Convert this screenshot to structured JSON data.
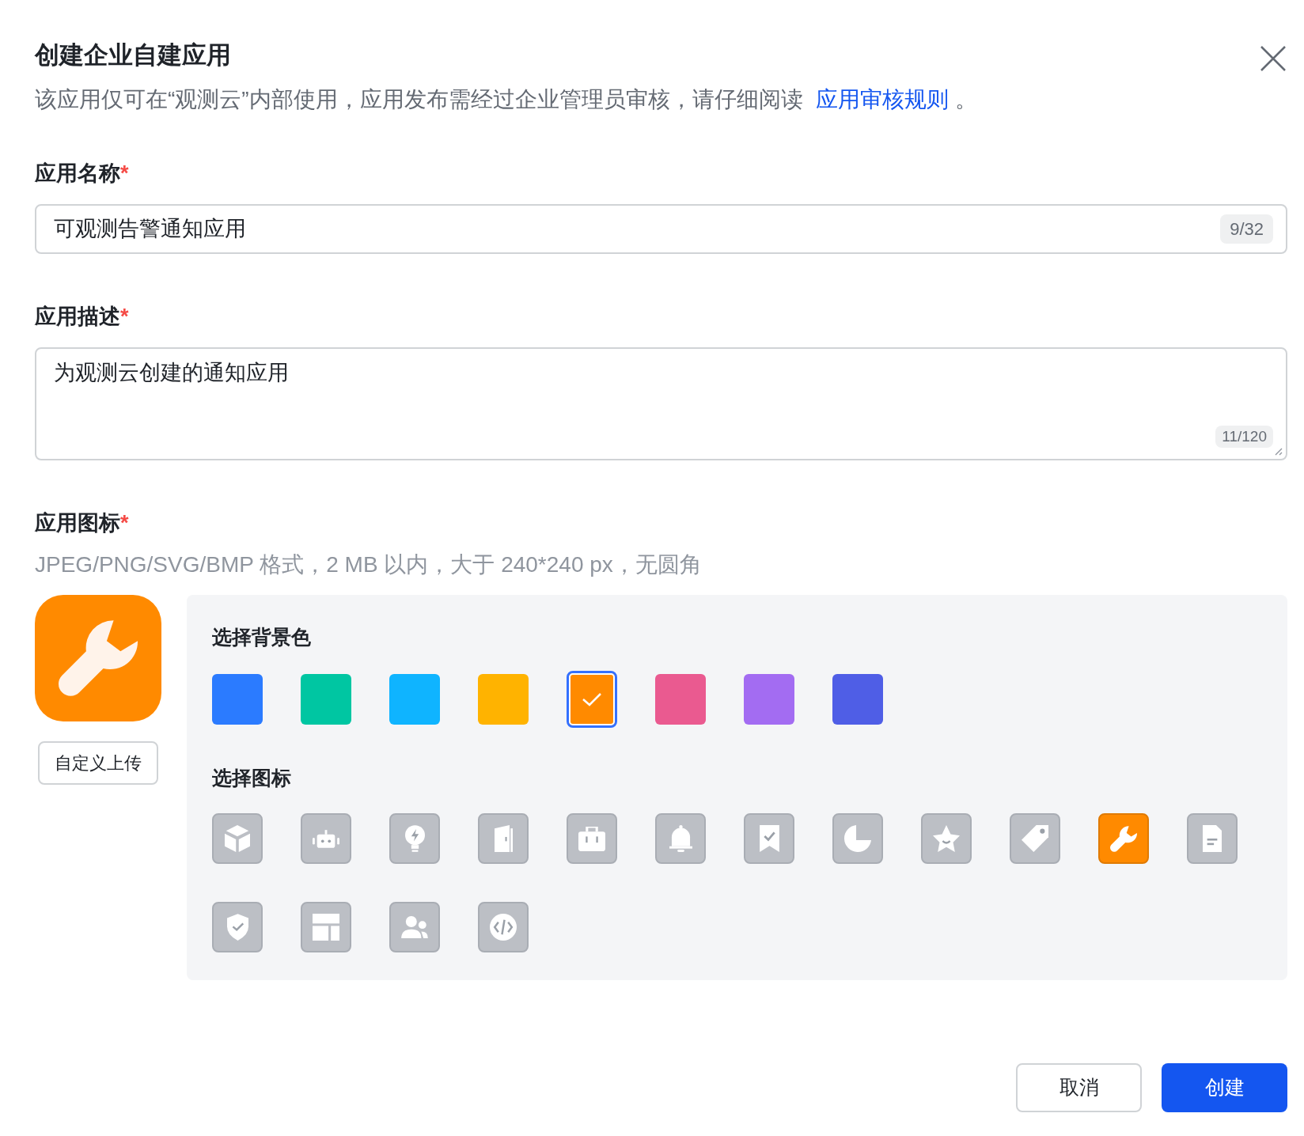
{
  "dialog": {
    "title": "创建企业自建应用",
    "description": "该应用仅可在“观测云”内部使用，应用发布需经过企业管理员审核，请仔细阅读",
    "description_link": "应用审核规则",
    "description_end": "。"
  },
  "name_field": {
    "label": "应用名称",
    "required_mark": "*",
    "value": "可观测告警通知应用",
    "counter": "9/32"
  },
  "description_field": {
    "label": "应用描述",
    "required_mark": "*",
    "value": "为观测云创建的通知应用",
    "counter": "11/120"
  },
  "icon_field": {
    "label": "应用图标",
    "required_mark": "*",
    "hint": "JPEG/PNG/SVG/BMP 格式，2 MB 以内，大于 240*240 px，无圆角",
    "upload_button": "自定义上传"
  },
  "background_colors": {
    "title": "选择背景色",
    "items": [
      {
        "color": "#2b7bff",
        "selected": false
      },
      {
        "color": "#00c6a2",
        "selected": false
      },
      {
        "color": "#0fb4ff",
        "selected": false
      },
      {
        "color": "#ffb300",
        "selected": false
      },
      {
        "color": "#ff8a00",
        "selected": true
      },
      {
        "color": "#ea5a90",
        "selected": false
      },
      {
        "color": "#a36cf2",
        "selected": false
      },
      {
        "color": "#4f5ee6",
        "selected": false
      }
    ]
  },
  "icons": {
    "title": "选择图标",
    "items": [
      {
        "kind": "cube",
        "selected": false
      },
      {
        "kind": "robot",
        "selected": false
      },
      {
        "kind": "bulb",
        "selected": false
      },
      {
        "kind": "door",
        "selected": false
      },
      {
        "kind": "briefcase",
        "selected": false
      },
      {
        "kind": "bell",
        "selected": false
      },
      {
        "kind": "bookmark",
        "selected": false
      },
      {
        "kind": "pie",
        "selected": false
      },
      {
        "kind": "star",
        "selected": false
      },
      {
        "kind": "tag",
        "selected": false
      },
      {
        "kind": "wrench",
        "selected": true
      },
      {
        "kind": "document",
        "selected": false
      },
      {
        "kind": "shield",
        "selected": false
      },
      {
        "kind": "layout",
        "selected": false
      },
      {
        "kind": "users",
        "selected": false
      },
      {
        "kind": "code",
        "selected": false
      }
    ]
  },
  "footer": {
    "cancel_button": "取消",
    "create_button": "创建"
  }
}
